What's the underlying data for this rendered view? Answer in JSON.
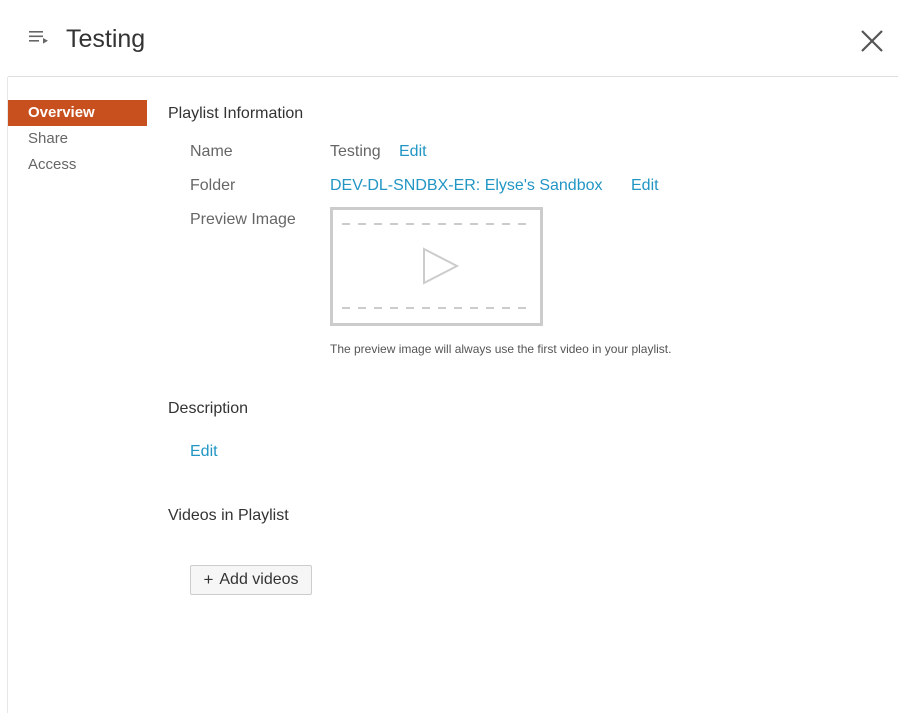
{
  "header": {
    "icon": "playlist-icon",
    "title": "Testing",
    "close_icon": "close-icon"
  },
  "sidebar": {
    "items": [
      {
        "label": "Overview",
        "active": true
      },
      {
        "label": "Share",
        "active": false
      },
      {
        "label": "Access",
        "active": false
      }
    ]
  },
  "info": {
    "section_title": "Playlist Information",
    "name_label": "Name",
    "name_value": "Testing",
    "name_edit": "Edit",
    "folder_label": "Folder",
    "folder_value": "DEV-DL-SNDBX-ER: Elyse's Sandbox",
    "folder_edit": "Edit",
    "preview_label": "Preview Image",
    "preview_icon": "video-placeholder-icon",
    "preview_note": "The preview image will always use the first video in your playlist."
  },
  "description": {
    "section_title": "Description",
    "edit": "Edit"
  },
  "videos": {
    "section_title": "Videos in Playlist",
    "add_button": "Add videos",
    "add_icon": "plus-icon"
  },
  "colors": {
    "accent": "#c8501e",
    "link": "#2196c4"
  }
}
